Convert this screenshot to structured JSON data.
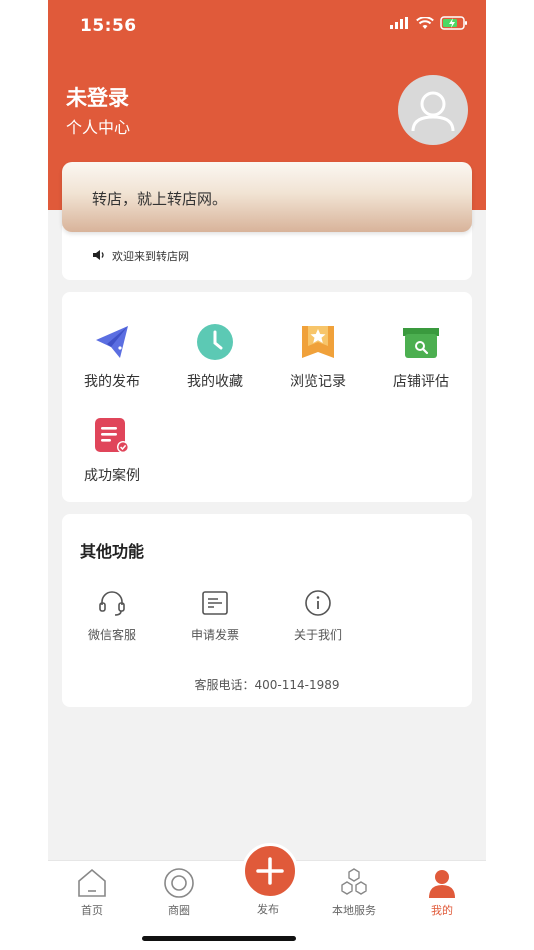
{
  "status_bar": {
    "time": "15:56"
  },
  "profile": {
    "name": "未登录",
    "subtitle": "个人中心"
  },
  "banner": {
    "text": "转店，就上转店网。"
  },
  "notice": {
    "text": "欢迎来到转店网"
  },
  "menu": {
    "items": [
      {
        "label": "我的发布",
        "icon": "paper-plane-icon",
        "color": "#5b6ee1"
      },
      {
        "label": "我的收藏",
        "icon": "clock-icon",
        "color": "#5cc9b4"
      },
      {
        "label": "浏览记录",
        "icon": "bookmark-star-icon",
        "color": "#f0a13a"
      },
      {
        "label": "店铺评估",
        "icon": "store-search-icon",
        "color": "#4caf50"
      },
      {
        "label": "成功案例",
        "icon": "document-check-icon",
        "color": "#e0455a"
      }
    ]
  },
  "other": {
    "title": "其他功能",
    "items": [
      {
        "label": "微信客服",
        "icon": "headset-icon"
      },
      {
        "label": "申请发票",
        "icon": "invoice-icon"
      },
      {
        "label": "关于我们",
        "icon": "info-icon"
      }
    ],
    "phone_text": "客服电话：400-114-1989"
  },
  "tabbar": {
    "items": [
      {
        "label": "首页",
        "icon": "home-icon"
      },
      {
        "label": "商圈",
        "icon": "circle-target-icon"
      },
      {
        "label": "发布",
        "icon": "plus-icon"
      },
      {
        "label": "本地服务",
        "icon": "hexagons-icon"
      },
      {
        "label": "我的",
        "icon": "person-icon"
      }
    ],
    "active": "我的"
  },
  "colors": {
    "accent": "#e05a3a"
  }
}
